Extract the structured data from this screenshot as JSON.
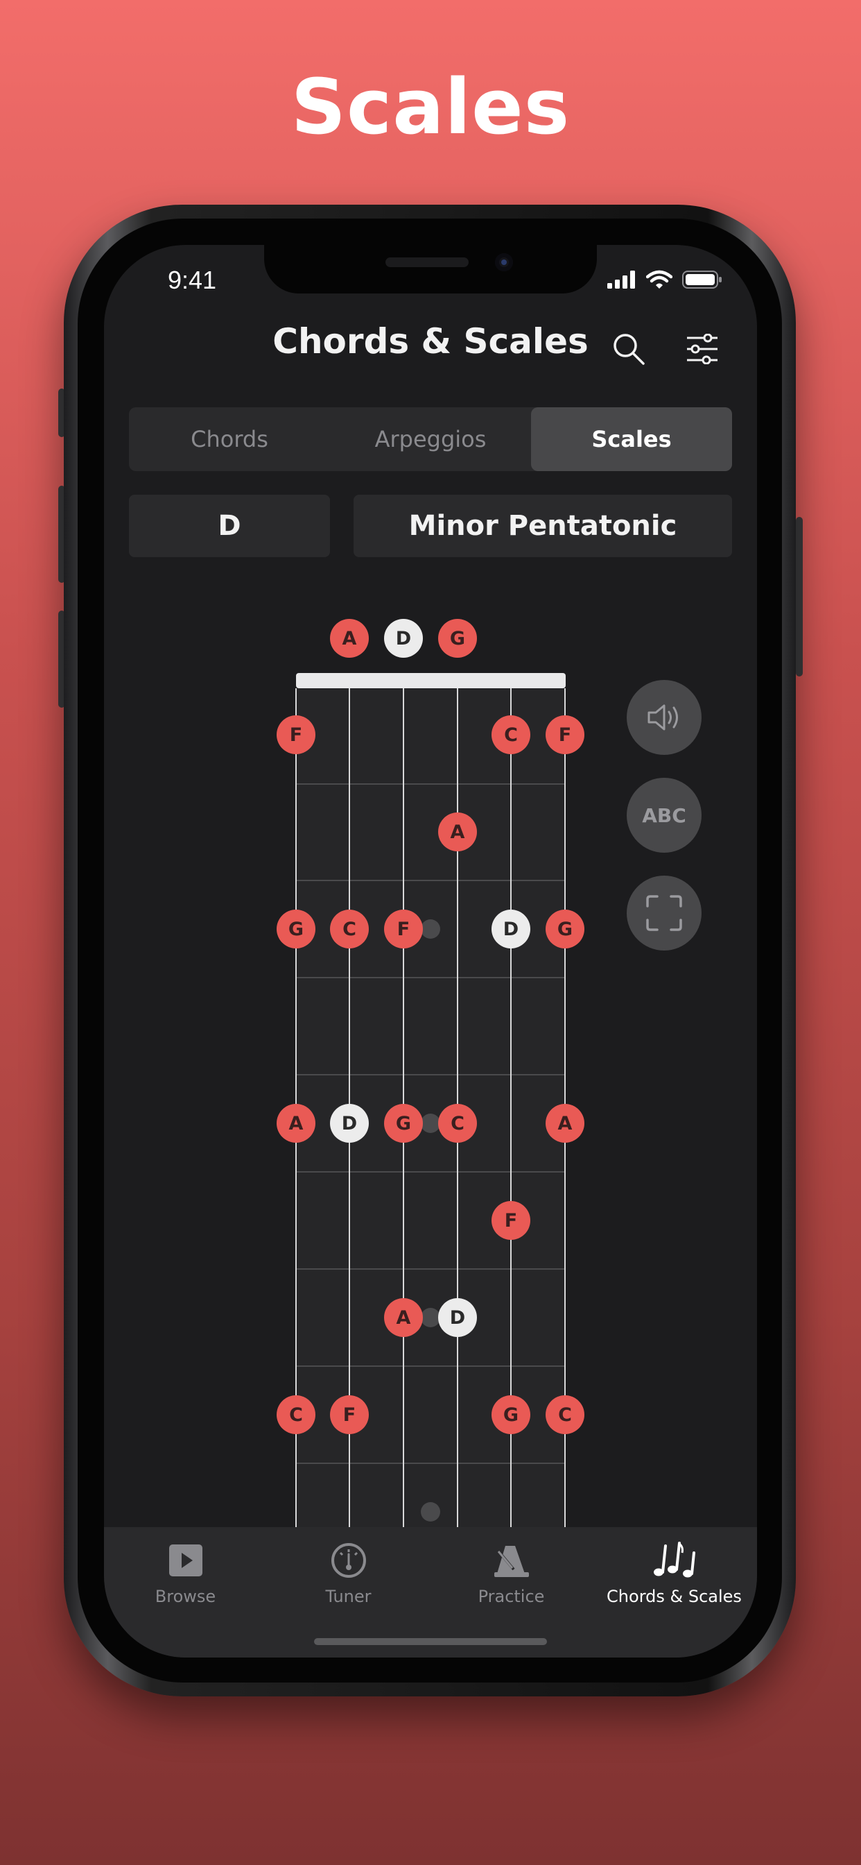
{
  "headline": "Scales",
  "status": {
    "time": "9:41"
  },
  "header": {
    "title": "Chords & Scales"
  },
  "segments": [
    {
      "label": "Chords",
      "active": false
    },
    {
      "label": "Arpeggios",
      "active": false
    },
    {
      "label": "Scales",
      "active": true
    }
  ],
  "pickers": {
    "key": "D",
    "scale": "Minor Pentatonic"
  },
  "fretboard": {
    "open_notes": [
      "A",
      "D",
      "G"
    ],
    "notes": [
      {
        "label": "A",
        "root": false
      },
      {
        "label": "D",
        "root": true
      },
      {
        "label": "G",
        "root": false
      },
      {
        "label": "F",
        "root": false
      },
      {
        "label": "C",
        "root": false
      },
      {
        "label": "F",
        "root": false
      },
      {
        "label": "A",
        "root": false
      },
      {
        "label": "G",
        "root": false
      },
      {
        "label": "C",
        "root": false
      },
      {
        "label": "F",
        "root": false
      },
      {
        "label": "D",
        "root": true
      },
      {
        "label": "G",
        "root": false
      },
      {
        "label": "A",
        "root": false
      },
      {
        "label": "D",
        "root": true
      },
      {
        "label": "G",
        "root": false
      },
      {
        "label": "C",
        "root": false
      },
      {
        "label": "A",
        "root": false
      },
      {
        "label": "F",
        "root": false
      },
      {
        "label": "A",
        "root": false
      },
      {
        "label": "D",
        "root": true
      },
      {
        "label": "C",
        "root": false
      },
      {
        "label": "F",
        "root": false
      },
      {
        "label": "G",
        "root": false
      },
      {
        "label": "C",
        "root": false
      }
    ]
  },
  "side_controls": {
    "label_toggle": "ABC"
  },
  "tabs": [
    {
      "label": "Browse",
      "icon": "play-icon",
      "active": false
    },
    {
      "label": "Tuner",
      "icon": "tuner-icon",
      "active": false
    },
    {
      "label": "Practice",
      "icon": "metronome-icon",
      "active": false
    },
    {
      "label": "Chords & Scales",
      "icon": "music-notes-icon",
      "active": true
    }
  ],
  "colors": {
    "accent": "#E95A55",
    "root": "#ECECEC",
    "background": "#1C1C1E"
  }
}
